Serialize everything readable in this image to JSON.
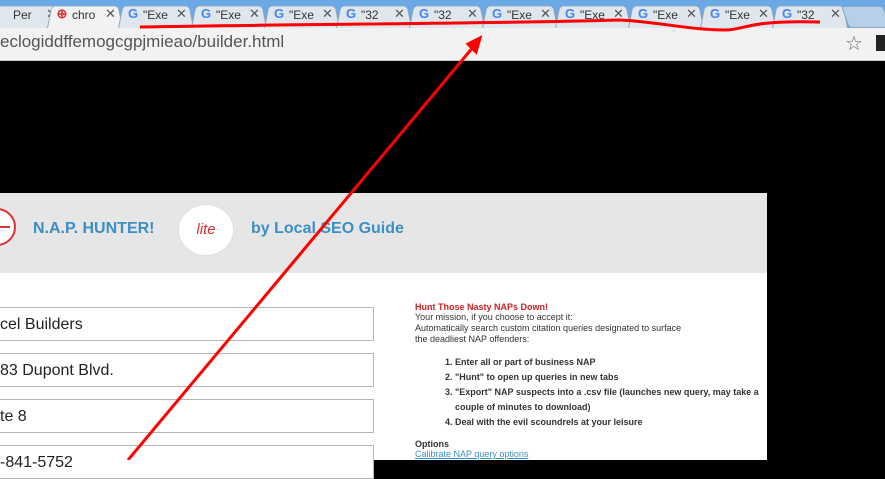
{
  "tabs": [
    {
      "title": "Per",
      "favicon": "page-icon",
      "active": false
    },
    {
      "title": "chro",
      "favicon": "nap-hunter-icon",
      "active": true
    },
    {
      "title": "\"Exe",
      "favicon": "google-icon",
      "active": false
    },
    {
      "title": "\"Exe",
      "favicon": "google-icon",
      "active": false
    },
    {
      "title": "\"Exe",
      "favicon": "google-icon",
      "active": false
    },
    {
      "title": "\"32",
      "favicon": "google-icon",
      "active": false
    },
    {
      "title": "\"32",
      "favicon": "google-icon",
      "active": false
    },
    {
      "title": "\"Exe",
      "favicon": "google-icon",
      "active": false
    },
    {
      "title": "\"Exe",
      "favicon": "google-icon",
      "active": false
    },
    {
      "title": "\"Exe",
      "favicon": "google-icon",
      "active": false
    },
    {
      "title": "\"Exe",
      "favicon": "google-icon",
      "active": false
    },
    {
      "title": "\"32",
      "favicon": "google-icon",
      "active": false
    }
  ],
  "toolbar": {
    "url": "eclogiddffemogcgpjmieao/builder.html"
  },
  "banner": {
    "brand": "N.A.P. HUNTER!",
    "badge": "lite",
    "byline": "by Local SEO Guide"
  },
  "form": {
    "fields": [
      {
        "name": "business-name-field",
        "value": "cel Builders"
      },
      {
        "name": "address-field",
        "value": "83 Dupont Blvd."
      },
      {
        "name": "address2-field",
        "value": "te 8"
      },
      {
        "name": "phone-field",
        "value": "-841-5752"
      }
    ]
  },
  "instructions": {
    "title": "Hunt Those Nasty NAPs Down!",
    "intro": [
      "Your mission, if you choose to accept it:",
      "Automatically search custom citation queries designated to surface",
      "the deadliest NAP offenders:"
    ],
    "steps": [
      "Enter all or part of business NAP",
      "\"Hunt\" to open up queries in new tabs",
      "\"Export\" NAP suspects into a .csv file (launches new query, may take a couple of minutes to download)",
      "Deal with the evil scoundrels at your leisure"
    ],
    "options_title": "Options",
    "options_link": "Calibrate NAP query options"
  },
  "colors": {
    "tabstrip": "#6ba8e6",
    "brand_blue": "#3b8fc4",
    "accent_red": "#cc2222",
    "annotation_red": "#ff0000"
  }
}
